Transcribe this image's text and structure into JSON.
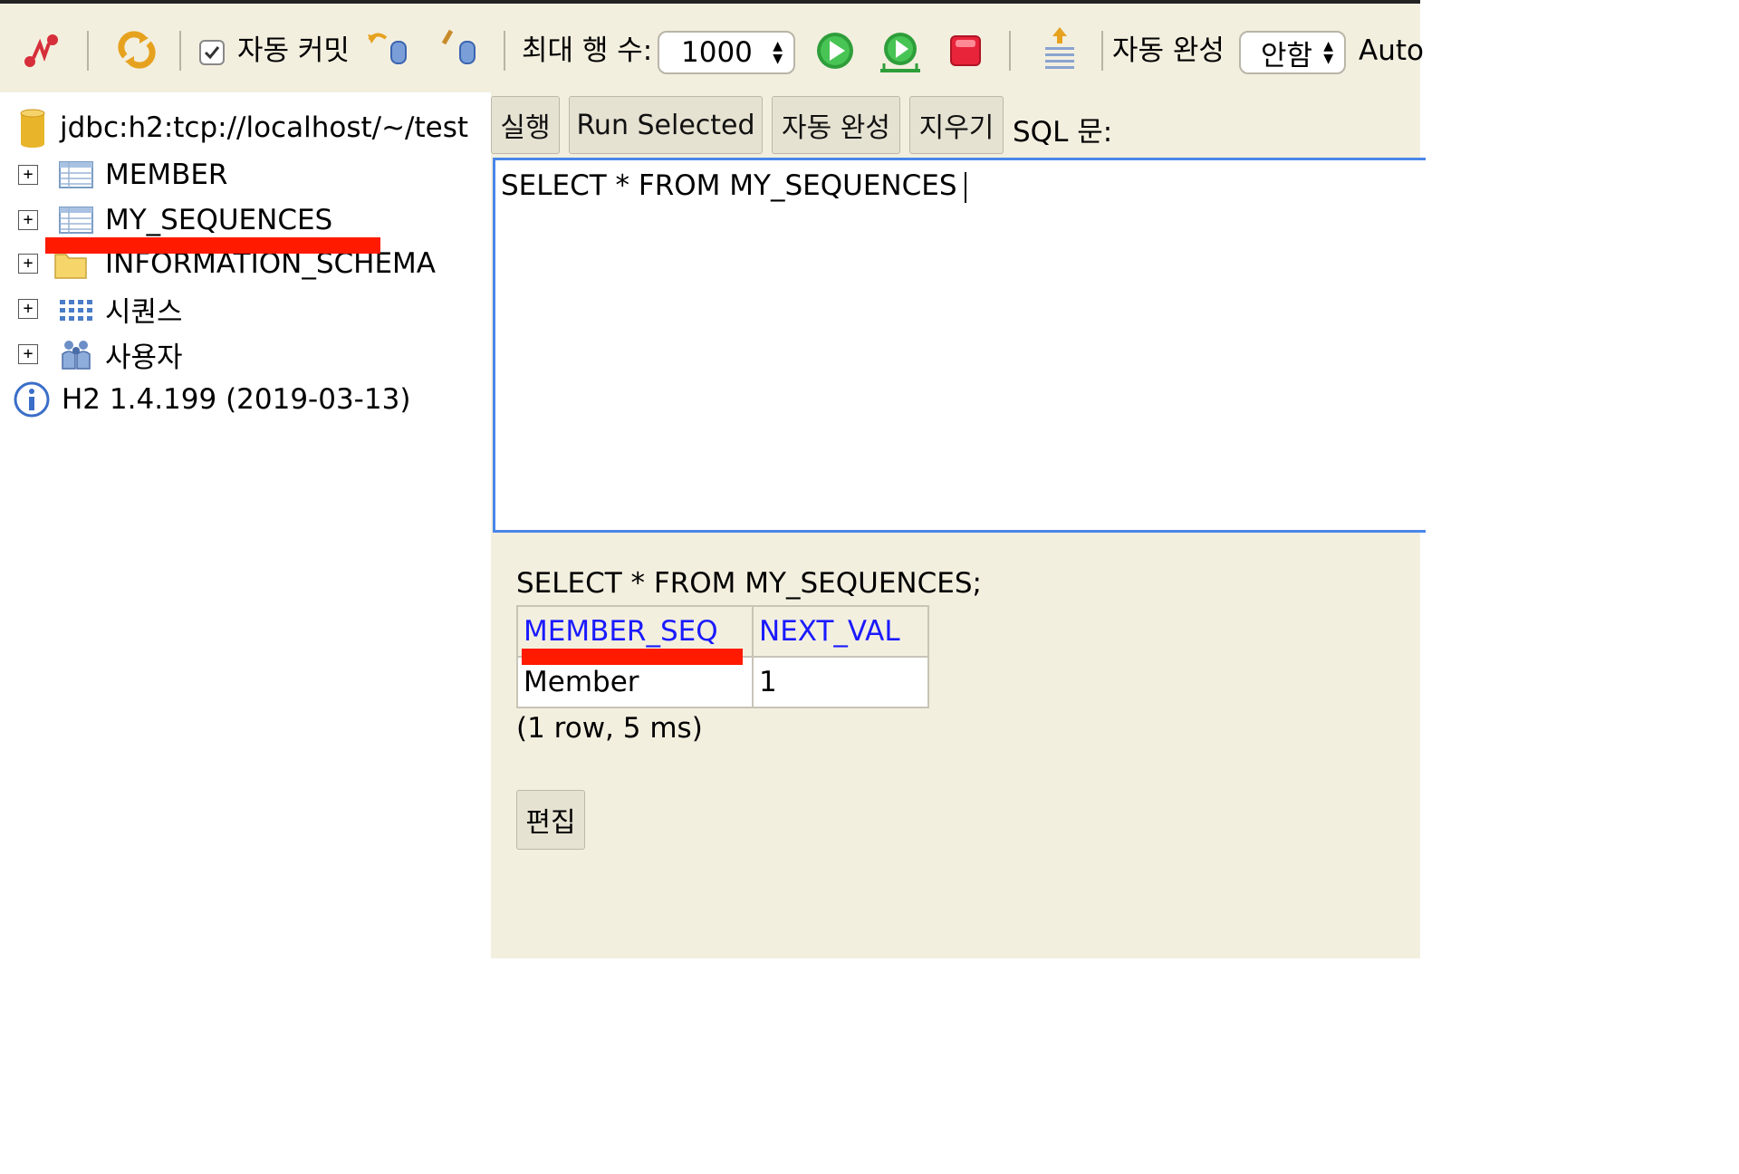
{
  "toolbar": {
    "auto_commit_label": "자동 커밋",
    "auto_commit_checked": true,
    "max_rows_label": "최대 행 수:",
    "max_rows_value": "1000",
    "autocomplete_label": "자동 완성",
    "autocomplete_value": "안함",
    "auto_label": "Auto",
    "icons": [
      "disconnect-icon",
      "refresh-icon",
      "rollback-icon",
      "commit-icon",
      "run-icon",
      "run-selected-icon",
      "stop-icon",
      "history-icon"
    ]
  },
  "tree": {
    "connection": "jdbc:h2:tcp://localhost/~/test",
    "items": [
      {
        "label": "MEMBER",
        "icon": "table-icon"
      },
      {
        "label": "MY_SEQUENCES",
        "icon": "table-icon"
      },
      {
        "label": "INFORMATION_SCHEMA",
        "icon": "folder-icon"
      },
      {
        "label": "시퀀스",
        "icon": "sequence-icon"
      },
      {
        "label": "사용자",
        "icon": "users-icon"
      }
    ],
    "version": "H2 1.4.199 (2019-03-13)"
  },
  "editor": {
    "buttons": {
      "run": "실행",
      "run_selected": "Run Selected",
      "autocomplete": "자동 완성",
      "clear": "지우기"
    },
    "sql_label": "SQL 문:",
    "sql_text": "SELECT * FROM MY_SEQUENCES"
  },
  "result": {
    "sql": "SELECT * FROM MY_SEQUENCES;",
    "columns": [
      "MEMBER_SEQ",
      "NEXT_VAL"
    ],
    "rows": [
      [
        "Member",
        "1"
      ]
    ],
    "info": "(1 row, 5 ms)",
    "edit_label": "편집"
  },
  "colors": {
    "accent_blue": "#4a86e8",
    "header_text": "#1a1aff",
    "highlight_red": "#ff1a00",
    "panel_bg": "#f3efdf"
  }
}
